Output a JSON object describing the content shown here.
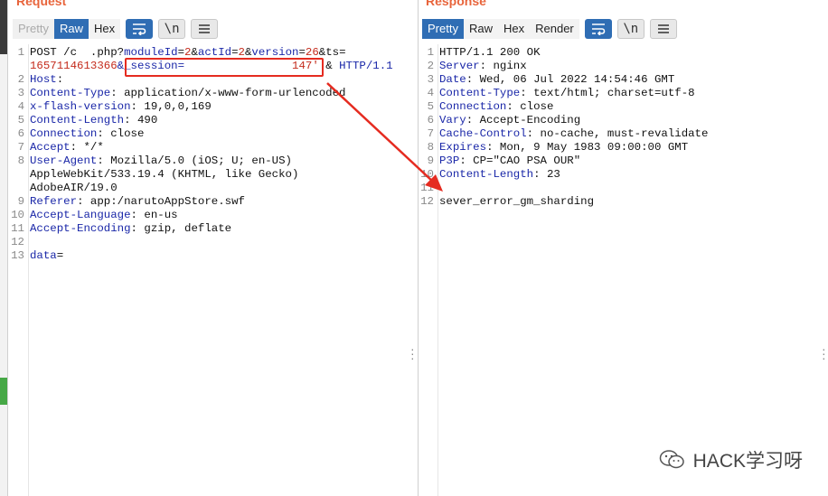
{
  "request": {
    "title": "Request",
    "tabs": [
      "Pretty",
      "Raw",
      "Hex"
    ],
    "newline_label": "\\n",
    "lines": [
      {
        "n": "1",
        "parts": [
          [
            "t",
            "POST /c  .php?"
          ],
          [
            "k",
            "moduleId"
          ],
          [
            "t",
            "="
          ],
          [
            "v",
            "2"
          ],
          [
            "t",
            "&"
          ],
          [
            "k",
            "actId"
          ],
          [
            "t",
            "="
          ],
          [
            "v",
            "2"
          ],
          [
            "t",
            "&"
          ],
          [
            "k",
            "version"
          ],
          [
            "t",
            "="
          ],
          [
            "v",
            "26"
          ],
          [
            "t",
            "&ts="
          ]
        ]
      },
      {
        "n": "",
        "parts": [
          [
            "v",
            "1657114613366"
          ],
          [
            "k",
            "&_session="
          ],
          [
            "t",
            "                "
          ],
          [
            "v",
            "147'"
          ],
          [
            "t",
            " & "
          ],
          [
            "k",
            "HTTP/1.1"
          ]
        ]
      },
      {
        "n": "2",
        "parts": [
          [
            "k",
            "Host"
          ],
          [
            "t",
            ":"
          ]
        ]
      },
      {
        "n": "3",
        "parts": [
          [
            "k",
            "Content-Type"
          ],
          [
            "t",
            ": application/x-www-form-urlencoded"
          ]
        ]
      },
      {
        "n": "4",
        "parts": [
          [
            "k",
            "x-flash-version"
          ],
          [
            "t",
            ": 19,0,0,169"
          ]
        ]
      },
      {
        "n": "5",
        "parts": [
          [
            "k",
            "Content-Length"
          ],
          [
            "t",
            ": 490"
          ]
        ]
      },
      {
        "n": "6",
        "parts": [
          [
            "k",
            "Connection"
          ],
          [
            "t",
            ": close"
          ]
        ]
      },
      {
        "n": "7",
        "parts": [
          [
            "k",
            "Accept"
          ],
          [
            "t",
            ": */*"
          ]
        ]
      },
      {
        "n": "8",
        "parts": [
          [
            "k",
            "User-Agent"
          ],
          [
            "t",
            ": Mozilla/5.0 (iOS; U; en-US)"
          ]
        ]
      },
      {
        "n": "",
        "parts": [
          [
            "t",
            "AppleWebKit/533.19.4 (KHTML, like Gecko)"
          ]
        ]
      },
      {
        "n": "",
        "parts": [
          [
            "t",
            "AdobeAIR/19.0"
          ]
        ]
      },
      {
        "n": "9",
        "parts": [
          [
            "k",
            "Referer"
          ],
          [
            "t",
            ": app:/narutoAppStore.swf"
          ]
        ]
      },
      {
        "n": "10",
        "parts": [
          [
            "k",
            "Accept-Language"
          ],
          [
            "t",
            ": en-us"
          ]
        ]
      },
      {
        "n": "11",
        "parts": [
          [
            "k",
            "Accept-Encoding"
          ],
          [
            "t",
            ": gzip, deflate"
          ]
        ]
      },
      {
        "n": "12",
        "parts": []
      },
      {
        "n": "13",
        "parts": [
          [
            "k",
            "data"
          ],
          [
            "t",
            "="
          ]
        ]
      }
    ]
  },
  "response": {
    "title": "Response",
    "tabs": [
      "Pretty",
      "Raw",
      "Hex",
      "Render"
    ],
    "newline_label": "\\n",
    "lines": [
      {
        "n": "1",
        "parts": [
          [
            "t",
            "HTTP/1.1 200 OK"
          ]
        ]
      },
      {
        "n": "2",
        "parts": [
          [
            "k",
            "Server"
          ],
          [
            "t",
            ": nginx"
          ]
        ]
      },
      {
        "n": "3",
        "parts": [
          [
            "k",
            "Date"
          ],
          [
            "t",
            ": Wed, 06 Jul 2022 14:54:46 GMT"
          ]
        ]
      },
      {
        "n": "4",
        "parts": [
          [
            "k",
            "Content-Type"
          ],
          [
            "t",
            ": text/html; charset=utf-8"
          ]
        ]
      },
      {
        "n": "5",
        "parts": [
          [
            "k",
            "Connection"
          ],
          [
            "t",
            ": close"
          ]
        ]
      },
      {
        "n": "6",
        "parts": [
          [
            "k",
            "Vary"
          ],
          [
            "t",
            ": Accept-Encoding"
          ]
        ]
      },
      {
        "n": "7",
        "parts": [
          [
            "k",
            "Cache-Control"
          ],
          [
            "t",
            ": no-cache, must-revalidate"
          ]
        ]
      },
      {
        "n": "8",
        "parts": [
          [
            "k",
            "Expires"
          ],
          [
            "t",
            ": Mon, 9 May 1983 09:00:00 GMT"
          ]
        ]
      },
      {
        "n": "9",
        "parts": [
          [
            "k",
            "P3P"
          ],
          [
            "t",
            ": CP=\"CAO PSA OUR\""
          ]
        ]
      },
      {
        "n": "10",
        "parts": [
          [
            "k",
            "Content-Length"
          ],
          [
            "t",
            ": 23"
          ]
        ]
      },
      {
        "n": "11",
        "parts": []
      },
      {
        "n": "12",
        "parts": [
          [
            "t",
            "sever_error_gm_sharding"
          ]
        ]
      }
    ]
  },
  "watermark": "HACK学习呀",
  "colors": {
    "accent": "#2f6db4",
    "title": "#e8643b",
    "annotation": "#e52b20",
    "key": "#1a27a8",
    "value": "#c42b1c"
  }
}
